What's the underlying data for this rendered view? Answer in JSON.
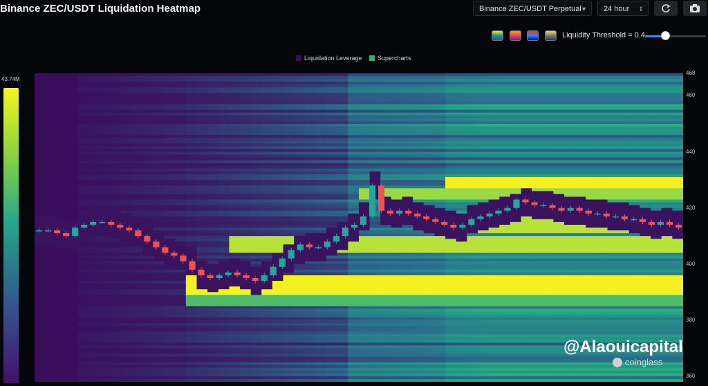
{
  "header": {
    "title": "Binance ZEC/USDT Liquidation Heatmap",
    "pair_select": "Binance ZEC/USDT Perpetual",
    "range_select": "24 hour",
    "refresh_icon": "refresh-icon",
    "camera_icon": "camera-icon"
  },
  "controls": {
    "palettes": [
      {
        "name": "viridis",
        "colors": [
          "#f5e626",
          "#21908d",
          "#3b528b"
        ]
      },
      {
        "name": "magma",
        "colors": [
          "#fca50a",
          "#e2476c",
          "#6b2a6c"
        ]
      },
      {
        "name": "jet",
        "colors": [
          "#ff3300",
          "#1e90ff",
          "#0000cc"
        ]
      },
      {
        "name": "cividis",
        "colors": [
          "#f5d94a",
          "#7c7b78",
          "#1f3a6b"
        ]
      }
    ],
    "threshold_label": "Liquidity Threshold = 0.4",
    "threshold_value": 0.4
  },
  "legend": {
    "items": [
      {
        "label": "Liquidation Leverage",
        "color": "#3b0e5c"
      },
      {
        "label": "Supercharts",
        "color": "#2bb673"
      }
    ]
  },
  "colorbar": {
    "max_label": "43.74M"
  },
  "watermark": {
    "handle": "@Alaouicapital",
    "brand": "coinglass"
  },
  "chart_data": {
    "type": "heatmap",
    "title": "Binance ZEC/USDT Liquidation Heatmap",
    "y_axis": {
      "ticks": [
        468,
        460,
        440,
        420,
        400,
        380,
        360
      ],
      "range": [
        358,
        468
      ]
    },
    "colorbar_max": "43.74M",
    "price_path": [
      412,
      412,
      411,
      410,
      413,
      414,
      415,
      415,
      414,
      413,
      412,
      410,
      408,
      406,
      404,
      403,
      401,
      398,
      396,
      395,
      396,
      397,
      396,
      395,
      394,
      396,
      399,
      402,
      405,
      407,
      406,
      406,
      408,
      410,
      413,
      414,
      417,
      428,
      419,
      418,
      419,
      418,
      417,
      416,
      415,
      414,
      413,
      414,
      416,
      417,
      418,
      419,
      420,
      423,
      422,
      421,
      421,
      420,
      419,
      420,
      419,
      418,
      418,
      417,
      417,
      416,
      416,
      415,
      414,
      415,
      414,
      413
    ],
    "liquidity_bands": [
      {
        "low": 427,
        "high": 431,
        "intensity": 1.0,
        "start": 0.63
      },
      {
        "low": 423,
        "high": 427,
        "intensity": 0.85,
        "start": 0.5
      },
      {
        "low": 411,
        "high": 417,
        "intensity": 0.9,
        "start": 0.63
      },
      {
        "low": 404,
        "high": 410,
        "intensity": 0.9,
        "start": 0.3
      },
      {
        "low": 389,
        "high": 396,
        "intensity": 1.0,
        "start": 0.23
      },
      {
        "low": 385,
        "high": 389,
        "intensity": 0.7,
        "start": 0.23
      }
    ]
  }
}
